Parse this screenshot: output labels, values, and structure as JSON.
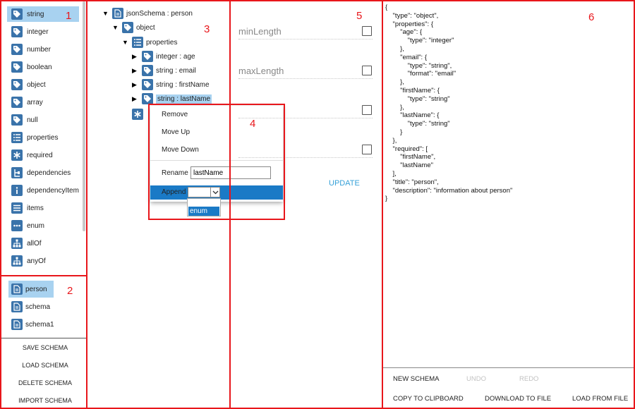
{
  "type_list": {
    "items": [
      {
        "label": "string",
        "icon": "tag-icon",
        "selected": true
      },
      {
        "label": "integer",
        "icon": "tag-icon"
      },
      {
        "label": "number",
        "icon": "tag-icon"
      },
      {
        "label": "boolean",
        "icon": "tag-icon"
      },
      {
        "label": "object",
        "icon": "tag-icon"
      },
      {
        "label": "array",
        "icon": "tag-icon"
      },
      {
        "label": "null",
        "icon": "tag-icon"
      },
      {
        "label": "properties",
        "icon": "list-icon"
      },
      {
        "label": "required",
        "icon": "asterisk-icon"
      },
      {
        "label": "dependencies",
        "icon": "dependencies-icon"
      },
      {
        "label": "dependencyItem",
        "icon": "info-icon"
      },
      {
        "label": "items",
        "icon": "lines-icon"
      },
      {
        "label": "enum",
        "icon": "dots-icon"
      },
      {
        "label": "allOf",
        "icon": "hierarchy-icon"
      },
      {
        "label": "anyOf",
        "icon": "hierarchy-icon"
      }
    ]
  },
  "schema_list": {
    "items": [
      {
        "label": "person",
        "selected": true
      },
      {
        "label": "schema"
      },
      {
        "label": "schema1"
      }
    ],
    "buttons": {
      "save": "SAVE SCHEMA",
      "load": "LOAD SCHEMA",
      "delete": "DELETE SCHEMA",
      "import": "IMPORT SCHEMA"
    }
  },
  "tree": {
    "root": "jsonSchema : person",
    "object": "object",
    "properties": "properties",
    "children": [
      "integer : age",
      "string : email",
      "string : firstName",
      "string : lastName"
    ],
    "collapse_glyph": "▼",
    "expand_glyph": "▶"
  },
  "context_menu": {
    "remove": "Remove",
    "move_up": "Move Up",
    "move_down": "Move Down",
    "rename_label": "Rename",
    "rename_value": "lastName",
    "append_label": "Append",
    "append_option": "enum"
  },
  "properties_panel": {
    "fields": [
      "minLength",
      "maxLength"
    ],
    "update": "UPDATE"
  },
  "json_text": "{\n    \"type\": \"object\",\n    \"properties\": {\n        \"age\": {\n            \"type\": \"integer\"\n        },\n        \"email\": {\n            \"type\": \"string\",\n            \"format\": \"email\"\n        },\n        \"firstName\": {\n            \"type\": \"string\"\n        },\n        \"lastName\": {\n            \"type\": \"string\"\n        }\n    },\n    \"required\": [\n        \"firstName\",\n        \"lastName\"\n    ],\n    \"title\": \"person\",\n    \"description\": \"information about person\"\n}",
  "toolbar": {
    "new_schema": "NEW SCHEMA",
    "undo": "UNDO",
    "redo": "REDO",
    "copy": "COPY TO CLIPBOARD",
    "download": "DOWNLOAD TO FILE",
    "load_file": "LOAD FROM FILE"
  },
  "region_numbers": [
    "1",
    "2",
    "3",
    "4",
    "5",
    "6"
  ],
  "colors": {
    "annotation": "#e8161b",
    "icon": "#3a73aa",
    "selection": "#a8d2f0",
    "accent": "#1a7ac6",
    "update": "#35a0d8"
  }
}
